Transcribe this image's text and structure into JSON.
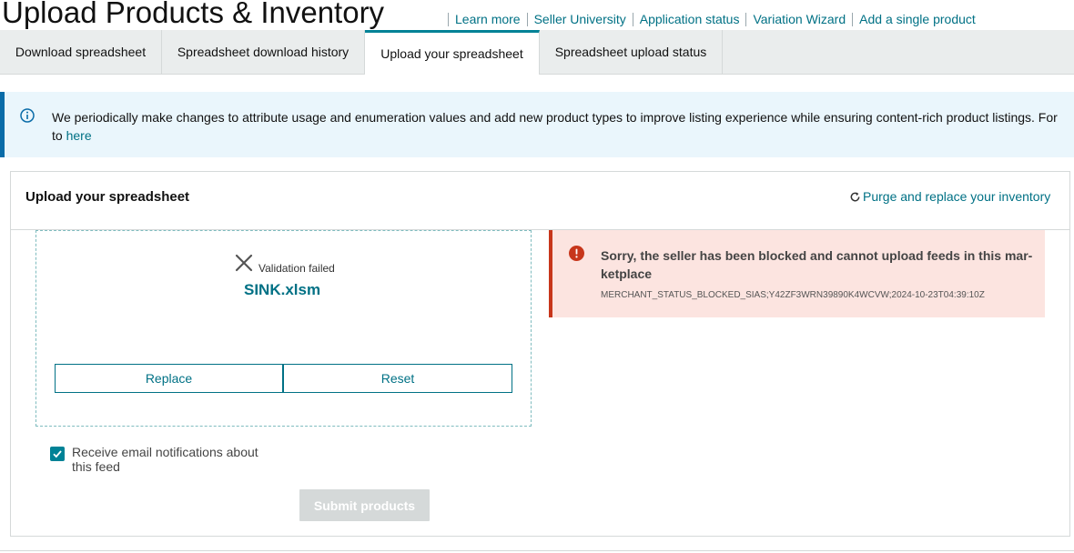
{
  "page": {
    "title": "Upload Products & Inventory"
  },
  "header_links": [
    "Learn more",
    "Seller University",
    "Application status",
    "Variation Wizard",
    "Add a single product"
  ],
  "tabs": [
    {
      "label": "Download spreadsheet",
      "active": false
    },
    {
      "label": "Spreadsheet download history",
      "active": false
    },
    {
      "label": "Upload your spreadsheet",
      "active": true
    },
    {
      "label": "Spreadsheet upload status",
      "active": false
    }
  ],
  "info_banner": {
    "icon": "info-icon",
    "text_line1": "We periodically make changes to attribute usage and enumeration values and add new product types to improve listing experience while ensuring content-rich product listings. For",
    "text_line2_prefix": "to ",
    "link_text": "here"
  },
  "upload_panel": {
    "title": "Upload your spreadsheet",
    "purge_link": "Purge and replace your inventory",
    "status_text": "Validation failed",
    "file_name": "SINK.xlsm",
    "replace_label": "Replace",
    "reset_label": "Reset",
    "email_label": "Receive email notifications about this feed",
    "email_checked": true,
    "submit_label": "Submit products"
  },
  "error": {
    "title": "Sorry, the seller has been blocked and cannot upload feeds in this mar-ketplace",
    "code": "MERCHANT_STATUS_BLOCKED_SIAS;Y42ZF3WRN39890K4WCVW;2024-10-23T04:39:10Z"
  },
  "colors": {
    "accent": "#008296",
    "link": "#007185",
    "error_border": "#c7361b",
    "error_bg": "#fce4e0",
    "info_bg": "#eaf6fc",
    "info_border": "#0a6ca8"
  }
}
